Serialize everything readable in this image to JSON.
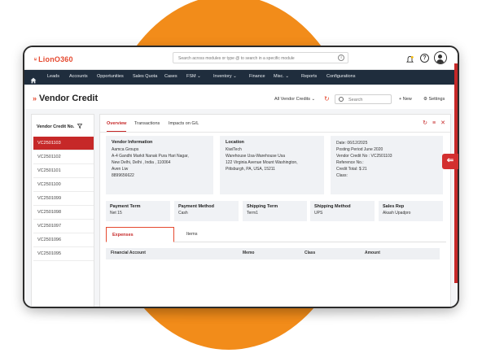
{
  "brand": {
    "logo_text": "LionO360"
  },
  "topbar": {
    "search_placeholder": "Search across modules or type @ to search in a specific module",
    "help_label": "?"
  },
  "nav": {
    "items": [
      "Leads",
      "Accounts",
      "Opportunities",
      "Sales Quota",
      "Cases",
      "FSM ⌄",
      "Inventory ⌄",
      "Finance",
      "Misc. ⌄",
      "Reports",
      "Configurations"
    ]
  },
  "page": {
    "title": "Vendor Credit",
    "filter": "All Vendor Credits  ⌄",
    "search_placeholder": "Search",
    "new_label": "+ New",
    "settings_label": "⚙ Settings"
  },
  "sidebar": {
    "header": "Vendor Credit No.",
    "items": [
      "VC2501103",
      "VC2501102",
      "VC2501101",
      "VC2501100",
      "VC2501099",
      "VC2501098",
      "VC2501097",
      "VC2501096",
      "VC2501095"
    ]
  },
  "tabs": [
    "Overview",
    "Transactions",
    "Impacts on G/L"
  ],
  "vendor": {
    "header": "Vendor Information",
    "lines": [
      "Aamca Groups",
      "A-4 Gandhi Markit Nanak Pura Hari Nagar,",
      "New Delhi, Delhi , India , 110064",
      "Aven Liw",
      "8899656622"
    ]
  },
  "location": {
    "header": "Location",
    "lines": [
      "KiwiTech",
      "Warehouse Usa-Warehouse Usa",
      "122 Virginia Avenue Mount Washington,",
      "Pittsburgh, PA, USA, 15211"
    ]
  },
  "details": {
    "lines": [
      "Date: 06/12/2025",
      "Posting Period June 2020",
      "Vendor Credit No : VC2501103",
      "Reference No.:",
      "Credit Total: $ 21",
      "Class:"
    ]
  },
  "terms": [
    {
      "label": "Payment Term",
      "value": "Net 15"
    },
    {
      "label": "Payment Method",
      "value": "Cash"
    },
    {
      "label": "Shipping Term",
      "value": "Term1"
    },
    {
      "label": "Shipping Method",
      "value": "UPS"
    },
    {
      "label": "Sales Rep",
      "value": "Akash Upadpro"
    }
  ],
  "subtabs": [
    "Expenses",
    "Items"
  ],
  "table": {
    "columns": [
      "Financial Account",
      "Memo",
      "Class",
      "Amount"
    ]
  },
  "colors": {
    "accent": "#c62828",
    "nav_bg": "#1f2d3d",
    "brand_orange": "#f28c1a"
  }
}
